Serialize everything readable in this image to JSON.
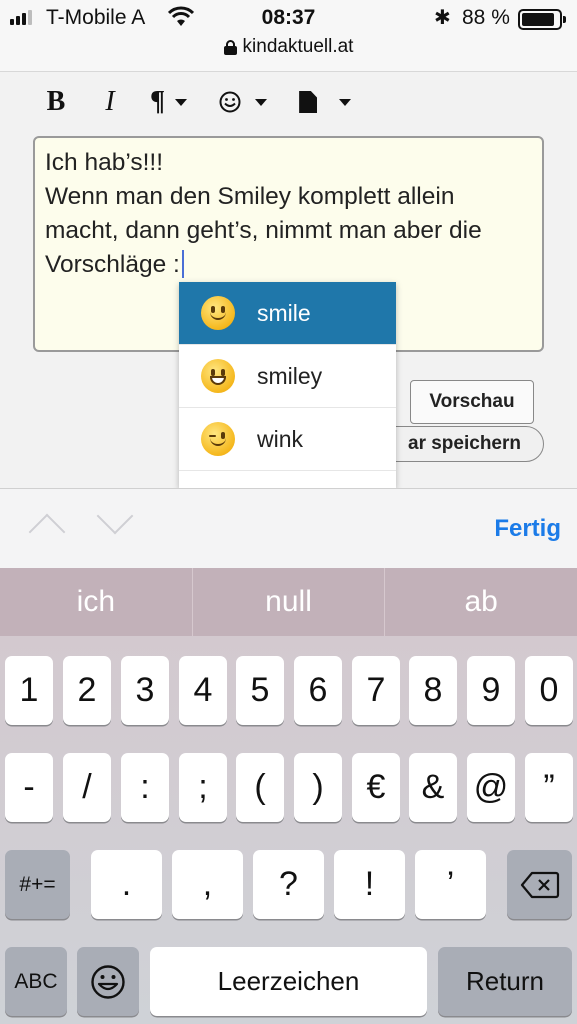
{
  "status_bar": {
    "carrier": "T-Mobile A",
    "time": "08:37",
    "battery_pct": "88 %"
  },
  "browser": {
    "url": "kindaktuell.at"
  },
  "toolbar": {
    "bold": "B",
    "italic": "I",
    "paragraph": "¶"
  },
  "editor": {
    "lines": [
      "Ich hab’s!!!",
      "Wenn man den Smiley komplett allein",
      "macht, dann geht’s, nimmt man aber die",
      "Vorschläge :"
    ]
  },
  "buttons": {
    "preview": "Vorschau",
    "save": "ar speichern"
  },
  "autocomplete": {
    "items": [
      {
        "label": "smile",
        "icon": "smile-emoji-icon",
        "active": true
      },
      {
        "label": "smiley",
        "icon": "smiley-emoji-icon",
        "active": false
      },
      {
        "label": "wink",
        "icon": "wink-emoji-icon",
        "active": false
      }
    ]
  },
  "keyboard_accessory": {
    "done": "Fertig"
  },
  "keyboard": {
    "suggestions": [
      "ich",
      "null",
      "ab"
    ],
    "row1": [
      "1",
      "2",
      "3",
      "4",
      "5",
      "6",
      "7",
      "8",
      "9",
      "0"
    ],
    "row2": [
      "-",
      "/",
      ":",
      ";",
      "(",
      ")",
      "€",
      "&",
      "@",
      "”"
    ],
    "row3": [
      ".",
      ",",
      "?",
      "!",
      "’"
    ],
    "symbols_key": "#+=",
    "abc_key": "ABC",
    "space": "Leerzeichen",
    "return": "Return"
  },
  "colors": {
    "accent": "#1b7be8",
    "dropdown_active": "#1f77aa",
    "editor_bg": "#fdfdec"
  }
}
